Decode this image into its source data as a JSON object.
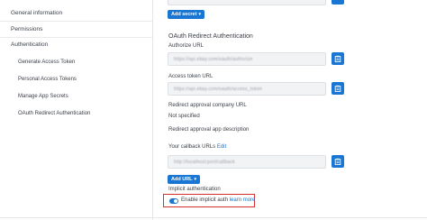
{
  "sidebar": {
    "items": [
      {
        "label": "General information"
      },
      {
        "label": "Permissions"
      },
      {
        "label": "Authentication"
      }
    ],
    "sub_items": [
      {
        "label": "Generate Access Token"
      },
      {
        "label": "Personal Access Tokens"
      },
      {
        "label": "Manage App Secrets"
      },
      {
        "label": "OAuth Redirect Authentication"
      }
    ]
  },
  "main": {
    "add_secret_label": "Add secret",
    "section_title": "OAuth Redirect Authentication",
    "authorize_url": {
      "label": "Authorize URL",
      "value": "https://api.ebay.com/oauth/authorize"
    },
    "access_token_url": {
      "label": "Access token URL",
      "value": "https://api.ebay.com/oauth/access_token"
    },
    "redirect_company": {
      "label": "Redirect approval company URL",
      "value": "Not specified"
    },
    "redirect_description": {
      "label": "Redirect approval app description"
    },
    "callback": {
      "label": "Your callback URLs",
      "edit_label": "Edit",
      "value": "http://localhost:port/callback"
    },
    "add_url_label": "Add URL",
    "implicit_auth": {
      "label": "Implicit authentication",
      "toggle_text": "Enable implicit auth",
      "learn_more": "learn more",
      "enabled": true
    }
  },
  "colors": {
    "accent": "#1976d2",
    "highlight": "#d32f2f"
  }
}
